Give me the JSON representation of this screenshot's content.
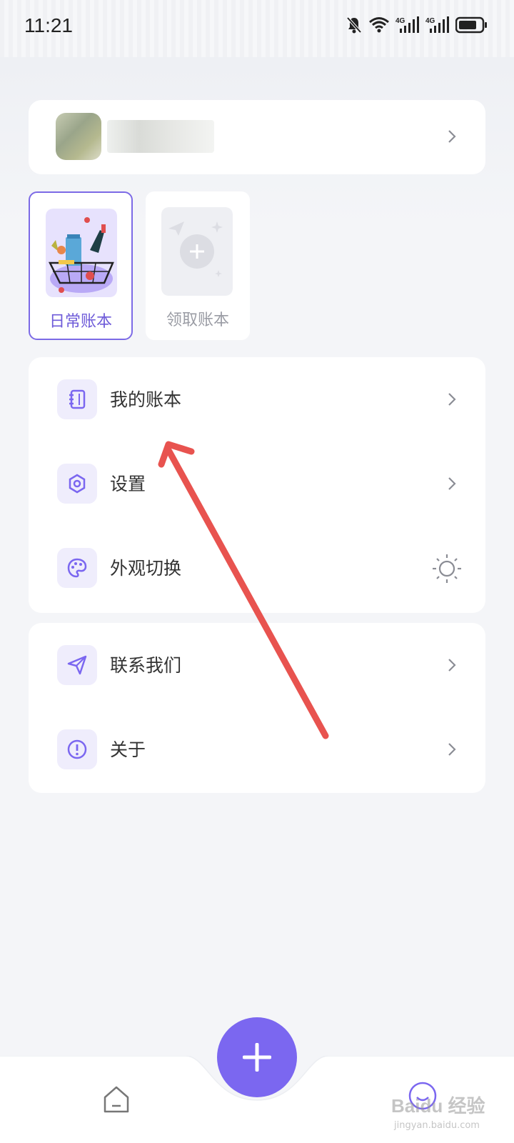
{
  "status_bar": {
    "time": "11:21",
    "network_1": "4G",
    "network_2": "4G"
  },
  "profile": {
    "name": ""
  },
  "books": [
    {
      "label": "日常账本",
      "active": true
    },
    {
      "label": "领取账本",
      "active": false
    }
  ],
  "menu_group_1": [
    {
      "label": "我的账本",
      "icon": "notebook-icon"
    },
    {
      "label": "设置",
      "icon": "settings-icon"
    },
    {
      "label": "外观切换",
      "icon": "palette-icon"
    }
  ],
  "menu_group_2": [
    {
      "label": "联系我们",
      "icon": "send-icon"
    },
    {
      "label": "关于",
      "icon": "info-icon"
    }
  ],
  "watermark": {
    "text": "Baidu 经验",
    "sub": "jingyan.baidu.com"
  },
  "colors": {
    "accent": "#7b67f0",
    "arrow": "#e8534f",
    "background": "#f4f5f8"
  }
}
